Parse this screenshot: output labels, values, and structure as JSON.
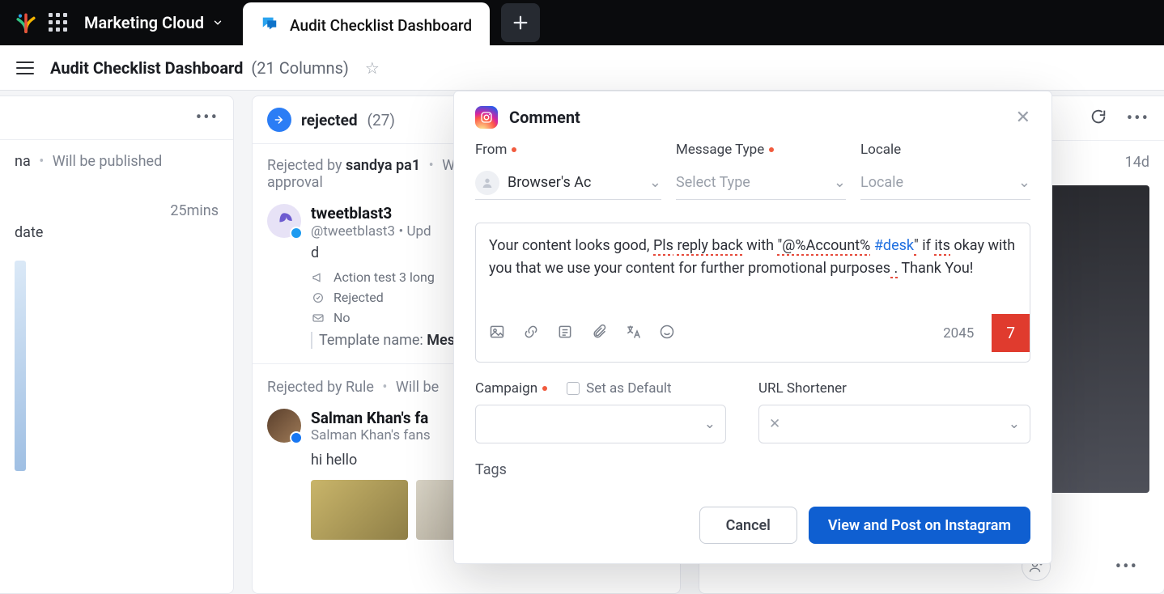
{
  "topbar": {
    "product": "Marketing Cloud",
    "active_tab": "Audit Checklist Dashboard"
  },
  "page": {
    "title": "Audit Checklist Dashboard",
    "subtitle": "(21 Columns)"
  },
  "left_col": {
    "status_fragment": "na",
    "status_note": "Will be published",
    "time": "25mins",
    "content_fragment": "date"
  },
  "main_col": {
    "name": "rejected",
    "count": "(27)",
    "card1": {
      "rejected_by_prefix": "Rejected by",
      "rejected_by": "sandya pa1",
      "trail_fragment": "W",
      "approval_word": "approval",
      "username": "tweetblast3",
      "handle": "@tweetblast3",
      "handle_suffix": "Upd",
      "body": "d",
      "meta_action": "Action test 3 long",
      "meta_status": "Rejected",
      "meta_reply": "No",
      "template_label": "Template name:",
      "template_value": "Mes"
    },
    "card2": {
      "line1": "Rejected by Rule",
      "line2": "Will be",
      "username": "Salman Khan's fa",
      "subline": "Salman Khan's fans",
      "body": "hi hello"
    }
  },
  "right_col": {
    "time": "14d"
  },
  "modal": {
    "title": "Comment",
    "from_label": "From",
    "from_value": "Browser's Ac",
    "type_label": "Message Type",
    "type_placeholder": "Select Type",
    "locale_label": "Locale",
    "locale_placeholder": "Locale",
    "editor": {
      "seg1": "Your content looks good, ",
      "seg2": "Pls",
      "seg3": " ",
      "seg4": "reply back",
      "seg5": " with ",
      "seg6": "\"@%Account%",
      "seg7": " ",
      "seg8": "#desk",
      "seg9": "\"",
      "seg10": " if ",
      "seg11": "its",
      "seg12": " okay with you that we use your content for further promotional purposes",
      "seg13": " .",
      "seg14": " Thank You!"
    },
    "char_count": "2045",
    "char_error": "7",
    "campaign_label": "Campaign",
    "set_default_label": "Set as Default",
    "url_label": "URL Shortener",
    "tags_label": "Tags",
    "cancel": "Cancel",
    "submit": "View and Post on Instagram"
  }
}
